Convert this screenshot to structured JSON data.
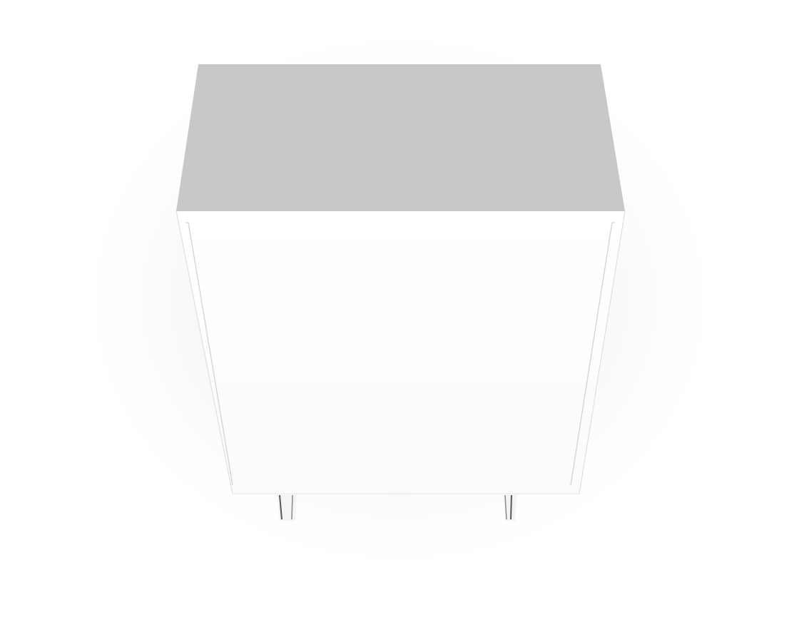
{
  "scene": {
    "subject": "cabinet",
    "colors": {
      "background": "#ffffff",
      "top_panel": "#c8c8c8",
      "front_panel": "#ffffff",
      "edge_line": "#d8d8d8",
      "shadow": "#e6e6e6",
      "leg": "#6a6a6a"
    }
  }
}
